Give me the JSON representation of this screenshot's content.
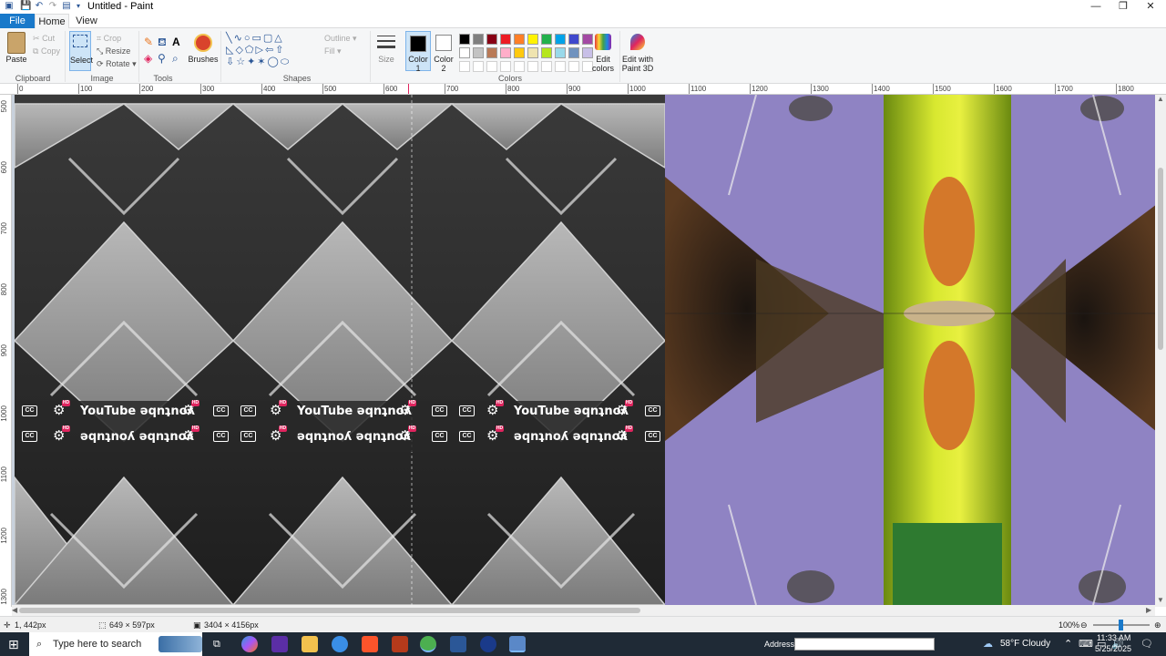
{
  "window": {
    "title": "Untitled - Paint",
    "minimize": "—",
    "maximize": "❐",
    "close": "✕"
  },
  "tabs": [
    "File",
    "Home",
    "View"
  ],
  "ribbon": {
    "clipboard": {
      "label": "Clipboard",
      "paste": "Paste",
      "cut": "Cut",
      "copy": "Copy"
    },
    "image": {
      "label": "Image",
      "select": "Select",
      "crop": "Crop",
      "resize": "Resize",
      "rotate": "Rotate"
    },
    "tools": {
      "label": "Tools"
    },
    "brushes": "Brushes",
    "shapes": {
      "label": "Shapes",
      "outline": "Outline",
      "fill": "Fill"
    },
    "size": "Size",
    "color1": "Color 1",
    "color2": "Color 2",
    "colors": {
      "label": "Colors",
      "edit": "Edit colors",
      "paint3d": "Edit with Paint 3D"
    },
    "palette_row1": [
      "#000000",
      "#7f7f7f",
      "#880015",
      "#ed1c24",
      "#ff7f27",
      "#fff200",
      "#22b14c",
      "#00a2e8",
      "#3f48cc",
      "#a349a4"
    ],
    "palette_row2": [
      "#ffffff",
      "#c3c3c3",
      "#b97a57",
      "#ffaec9",
      "#ffc90e",
      "#efe4b0",
      "#b5e61d",
      "#99d9ea",
      "#7092be",
      "#c8bfe7"
    ]
  },
  "ruler_top": [
    "0",
    "100",
    "200",
    "300",
    "400",
    "500",
    "600",
    "700",
    "800",
    "900",
    "1000",
    "1100",
    "1200",
    "1300",
    "1400",
    "1500",
    "1600",
    "1700",
    "1800"
  ],
  "ruler_left": [
    "500",
    "600",
    "700",
    "800",
    "900",
    "1000",
    "1100",
    "1200",
    "1300"
  ],
  "overlay": {
    "youtube_text": "YouTube",
    "youtube_mirrored": "ǝqnʇnoʎ",
    "cc": "CC",
    "hd": "HD"
  },
  "status": {
    "cursor": "1, 442px",
    "selection": "649 × 597px",
    "image_size": "3404 × 4156px",
    "zoom": "100%"
  },
  "taskbar": {
    "search_placeholder": "Type here to search",
    "address_label": "Address",
    "weather": "58°F  Cloudy",
    "time": "11:33 AM",
    "date": "5/25/2025"
  }
}
